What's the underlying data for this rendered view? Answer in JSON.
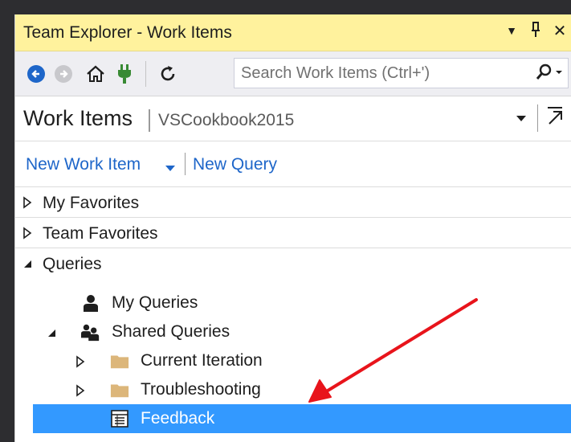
{
  "titlebar": {
    "title": "Team Explorer - Work Items",
    "dropdown_glyph": "▼",
    "pin_glyph": "↕",
    "close_glyph": "✕"
  },
  "toolbar": {
    "search_placeholder": "Search Work Items (Ctrl+')"
  },
  "header": {
    "title": "Work Items",
    "project": "VSCookbook2015"
  },
  "actions": {
    "new_work_item": "New Work Item",
    "new_query": "New Query"
  },
  "sections": {
    "my_favorites": "My Favorites",
    "team_favorites": "Team Favorites",
    "queries": "Queries"
  },
  "tree": {
    "my_queries": "My Queries",
    "shared_queries": "Shared Queries",
    "current_iteration": "Current Iteration",
    "troubleshooting": "Troubleshooting",
    "feedback": "Feedback"
  },
  "colors": {
    "titlebar_bg": "#fff29d",
    "link": "#1e66c9",
    "selection": "#3399ff",
    "annotation": "#e8141b",
    "folder": "#dcb67a",
    "nav_blue": "#1e66c9",
    "connect_green": "#388a34"
  }
}
